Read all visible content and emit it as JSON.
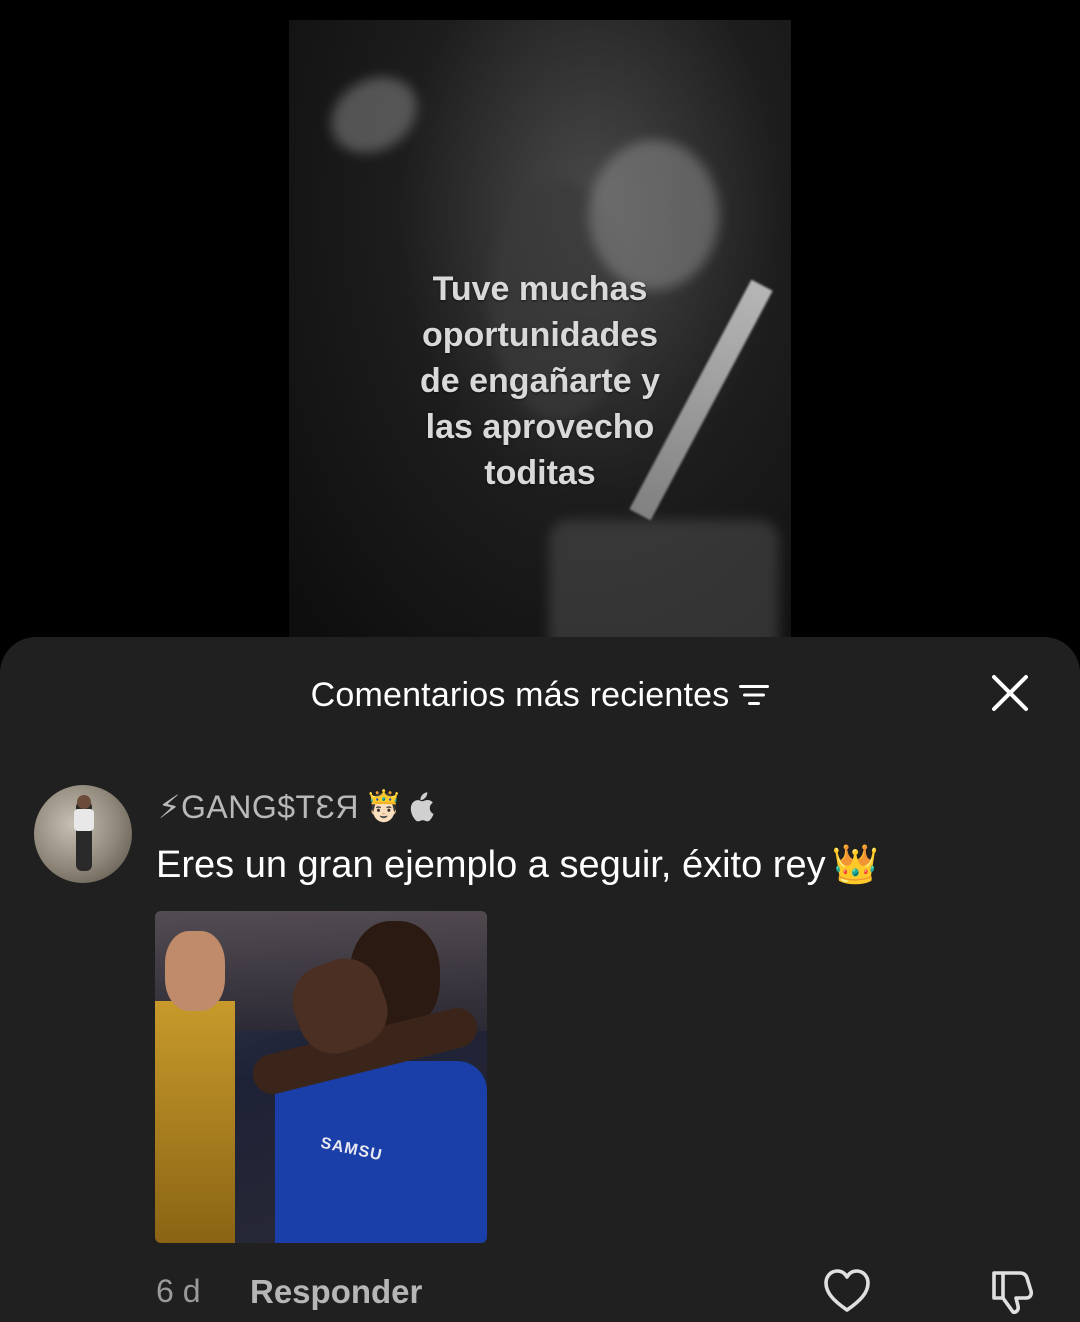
{
  "video": {
    "caption": "Tuve muchas\noportunidades\nde engañarte y\nlas aprovecho\ntoditas"
  },
  "sheet": {
    "title": "Comentarios más recientes",
    "filter_icon": "filter-lines-icon",
    "close_icon": "close-icon"
  },
  "comment": {
    "username": "⚡GANG$TƐЯ",
    "badge_emoji": "🤴🏻",
    "platform_icon": "apple-icon",
    "text": "Eres un gran ejemplo a seguir, éxito rey",
    "text_emoji": "👑",
    "gif_sponsor_text": "SAMSU",
    "time": "6 d",
    "reply_label": "Responder",
    "like_icon": "heart-outline-icon",
    "dislike_icon": "thumbs-down-icon"
  },
  "colors": {
    "sheet_bg": "#202020",
    "page_bg": "#000000",
    "username": "#b9b9b9",
    "meta_text": "#9a9a9a"
  }
}
